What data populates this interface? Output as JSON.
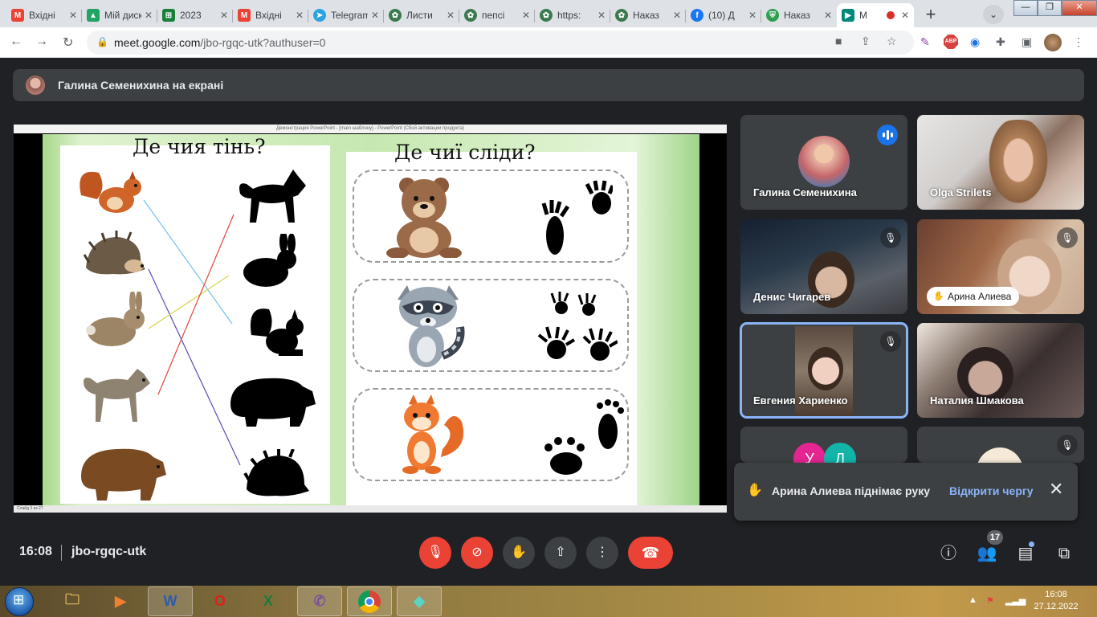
{
  "browser": {
    "tabs": [
      {
        "title": "Вхідні",
        "favicon": "gmail-icon",
        "color": "#ea4335",
        "glyph": "M"
      },
      {
        "title": "Мій диск",
        "favicon": "drive-icon",
        "color": "#1fa463",
        "glyph": "▲"
      },
      {
        "title": "2023",
        "favicon": "sheets-icon",
        "color": "#188038",
        "glyph": "⊞"
      },
      {
        "title": "Вхідні",
        "favicon": "gmail-icon",
        "color": "#ea4335",
        "glyph": "M"
      },
      {
        "title": "Telegram",
        "favicon": "telegram-icon",
        "color": "#2aa3e0",
        "glyph": "➤"
      },
      {
        "title": "Листи",
        "favicon": "site-icon",
        "color": "#3b7a4f",
        "glyph": "✿"
      },
      {
        "title": "пепсі",
        "favicon": "site-icon",
        "color": "#3b7a4f",
        "glyph": "✿"
      },
      {
        "title": "https:",
        "favicon": "site-icon",
        "color": "#3b7a4f",
        "glyph": "✿"
      },
      {
        "title": "Наказ",
        "favicon": "site-icon",
        "color": "#3b7a4f",
        "glyph": "✿"
      },
      {
        "title": "(10) Д",
        "favicon": "facebook-icon",
        "color": "#1877f2",
        "glyph": "f"
      },
      {
        "title": "Наказ",
        "favicon": "shield-icon",
        "color": "#2e9e4f",
        "glyph": "⛨"
      },
      {
        "title": "M",
        "favicon": "meet-icon",
        "color": "#00897b",
        "glyph": "▶"
      }
    ],
    "url_host": "meet.google.com",
    "url_path": "/jbo-rgqc-utk?authuser=0",
    "abp_label": "ABP"
  },
  "meet": {
    "presenting_banner": "Галина Семенихина на екрані",
    "meeting_time": "16:08",
    "meeting_code": "jbo-rgqc-utk",
    "participant_count": "17",
    "participants": [
      {
        "name": "Галина Семенихина",
        "speaking": true
      },
      {
        "name": "Olga Strilets"
      },
      {
        "name": "Денис Чигарев",
        "muted": true
      },
      {
        "name": "Арина Алиева",
        "muted": true,
        "hand_raised": true
      },
      {
        "name": "Евгения Хариенко",
        "muted": true,
        "selected": true
      },
      {
        "name": "Наталия Шмакова"
      },
      {
        "initials": [
          "У",
          "Л"
        ]
      },
      {
        "muted": true
      }
    ],
    "notification": {
      "message": "Арина Алиева піднімає руку",
      "action": "Відкрити чергу"
    },
    "accent": "#8ab4f8",
    "danger": "#ea4335"
  },
  "slide": {
    "window_title": "Демонстрация PowerPoint - [main шаблону] - PowerPoint (Сбой активации продукта)",
    "status": "Слайд 3 из 27",
    "left_title": "Де чия тінь?",
    "right_title": "Де чиї сліди?"
  },
  "taskbar": {
    "time": "16:08",
    "date": "27.12.2022",
    "apps": [
      "explorer",
      "media-player",
      "word",
      "opera",
      "excel",
      "viber",
      "chrome",
      "filmora"
    ]
  }
}
